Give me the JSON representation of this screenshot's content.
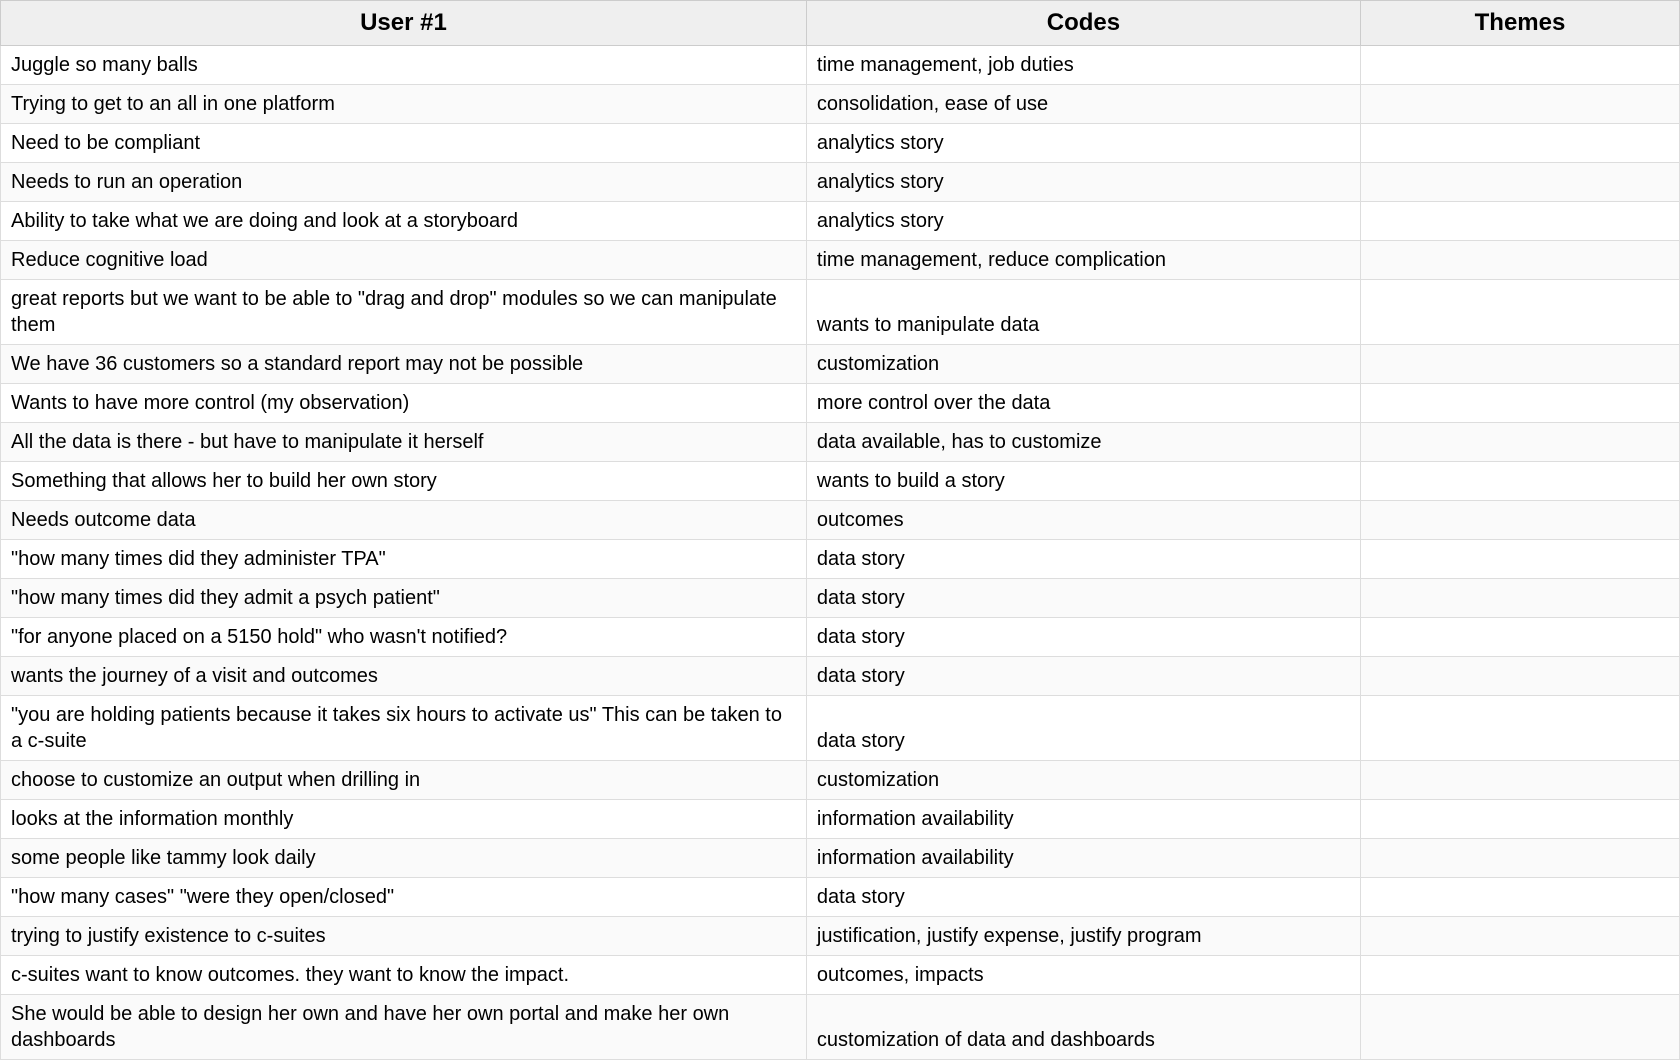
{
  "table": {
    "headers": {
      "user": "User #1",
      "codes": "Codes",
      "themes": "Themes"
    },
    "rows": [
      {
        "user": "Juggle so many balls",
        "codes": "time management, job duties",
        "themes": ""
      },
      {
        "user": "Trying to get to an all in one platform",
        "codes": "consolidation, ease of use",
        "themes": ""
      },
      {
        "user": "Need to be compliant",
        "codes": "analytics story",
        "themes": ""
      },
      {
        "user": "Needs to run an operation",
        "codes": "analytics story",
        "themes": ""
      },
      {
        "user": "Ability to take what we are doing and look at a storyboard",
        "codes": "analytics story",
        "themes": ""
      },
      {
        "user": "Reduce cognitive load",
        "codes": "time management, reduce complication",
        "themes": ""
      },
      {
        "user": "great reports but we want to be able to \"drag and drop\" modules so we can manipulate them",
        "codes": "wants to manipulate data",
        "themes": ""
      },
      {
        "user": "We have 36 customers so a standard report may not be possible",
        "codes": "customization",
        "themes": ""
      },
      {
        "user": "Wants to have more control (my observation)",
        "codes": "more control over the data",
        "themes": ""
      },
      {
        "user": "All the data is there - but have to manipulate it herself",
        "codes": "data available, has to customize",
        "themes": ""
      },
      {
        "user": "Something that allows her to build her own story",
        "codes": "wants to build a story",
        "themes": ""
      },
      {
        "user": "Needs outcome data",
        "codes": "outcomes",
        "themes": ""
      },
      {
        "user": "\"how many times did they administer TPA\"",
        "codes": "data story",
        "themes": ""
      },
      {
        "user": "\"how many times did they admit a psych patient\"",
        "codes": "data story",
        "themes": ""
      },
      {
        "user": "\"for anyone placed on a 5150 hold\" who wasn't notified?",
        "codes": "data story",
        "themes": ""
      },
      {
        "user": "wants the journey of a visit and outcomes",
        "codes": "data story",
        "themes": ""
      },
      {
        "user": "\"you are holding patients because it takes six hours to activate us\" This can be taken to a c-suite",
        "codes": "data story",
        "themes": ""
      },
      {
        "user": "choose to customize an output when drilling in",
        "codes": "customization",
        "themes": ""
      },
      {
        "user": "looks at the information monthly",
        "codes": "information availability",
        "themes": ""
      },
      {
        "user": "some people like tammy look daily",
        "codes": "information availability",
        "themes": ""
      },
      {
        "user": "\"how many cases\" \"were they open/closed\"",
        "codes": "data story",
        "themes": ""
      },
      {
        "user": "trying to justify existence to c-suites",
        "codes": "justification, justify expense, justify program",
        "themes": ""
      },
      {
        "user": "c-suites want to know outcomes. they want to know the impact.",
        "codes": "outcomes, impacts",
        "themes": ""
      },
      {
        "user": "She would be able to design her own and have her own portal and make her own dashboards",
        "codes": "customization of data and dashboards",
        "themes": ""
      }
    ]
  }
}
